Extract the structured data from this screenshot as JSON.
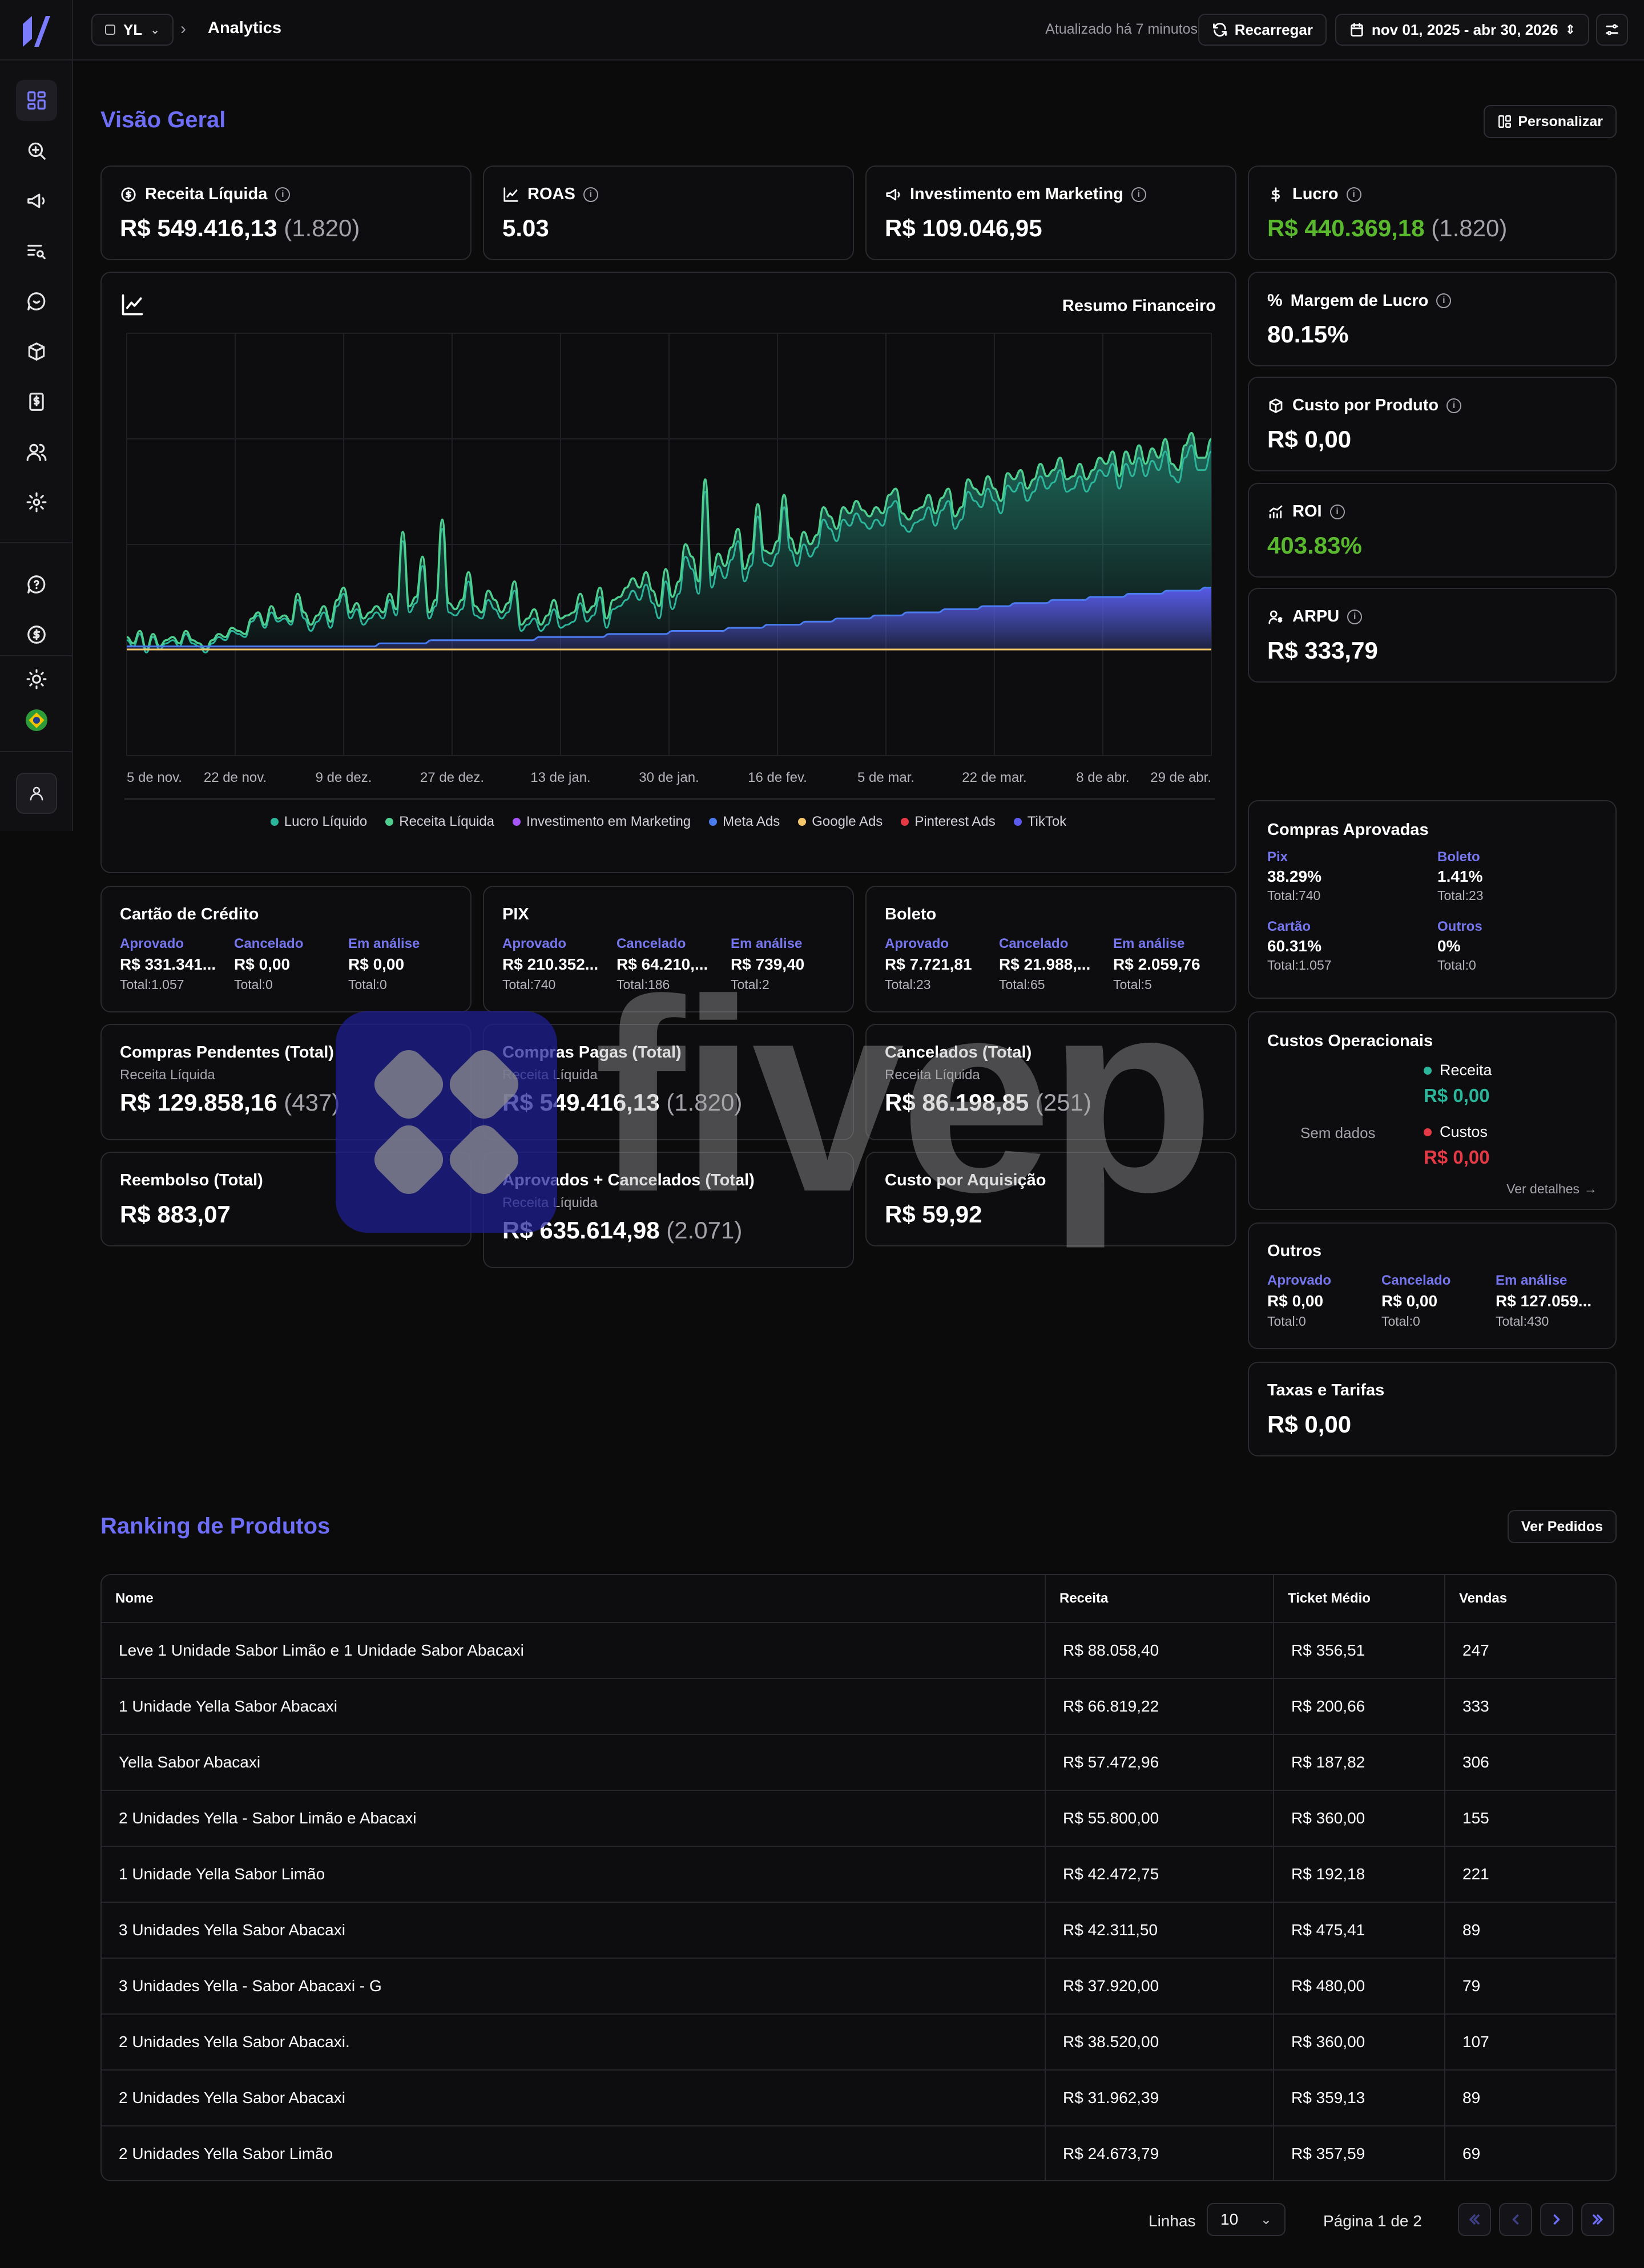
{
  "topbar": {
    "workspace": "YL",
    "breadcrumb": "Analytics",
    "updated": "Atualizado há 7 minutos",
    "reload": "Recarregar",
    "date_range": "nov 01, 2025 - abr 30, 2026"
  },
  "overview": {
    "title": "Visão Geral",
    "customize": "Personalizar",
    "kpis": {
      "receita": {
        "label": "Receita Líquida",
        "value": "R$ 549.416,13",
        "count": "(1.820)"
      },
      "roas": {
        "label": "ROAS",
        "value": "5.03"
      },
      "investimento": {
        "label": "Investimento em Marketing",
        "value": "R$ 109.046,95"
      },
      "lucro": {
        "label": "Lucro",
        "value": "R$ 440.369,18",
        "count": "(1.820)"
      },
      "margem": {
        "label": "Margem de Lucro",
        "value": "80.15%"
      },
      "custo_produto": {
        "label": "Custo por Produto",
        "value": "R$ 0,00"
      },
      "roi": {
        "label": "ROI",
        "value": "403.83%"
      },
      "arpu": {
        "label": "ARPU",
        "value": "R$ 333,79"
      }
    }
  },
  "colors": {
    "accent": "#6d6df5",
    "lucro": "#2bb59a",
    "receita": "#4fcf8f",
    "investimento": "#a855f7",
    "meta": "#4a7cf0",
    "google": "#f5c66a",
    "pinterest": "#e63946",
    "tiktok": "#5b5bf0",
    "positive": "#5ab82e"
  },
  "chart_data": {
    "type": "area",
    "title": "Resumo Financeiro",
    "x_ticks": [
      "5 de nov.",
      "22 de nov.",
      "9 de dez.",
      "27 de dez.",
      "13 de jan.",
      "30 de jan.",
      "16 de fev.",
      "5 de mar.",
      "22 de mar.",
      "8 de abr.",
      "29 de abr."
    ],
    "grid": true,
    "legend_position": "bottom",
    "series_names": [
      "Lucro Líquido",
      "Receita Líquida",
      "Investimento em Marketing",
      "Meta Ads",
      "Google Ads",
      "Pinterest Ads",
      "TikTok"
    ],
    "receita": [
      0.04,
      0.02,
      0.06,
      0.0,
      0.05,
      0.01,
      0.03,
      0.04,
      0.02,
      0.06,
      0.03,
      0.02,
      0.0,
      0.03,
      0.05,
      0.04,
      0.07,
      0.06,
      0.05,
      0.1,
      0.12,
      0.08,
      0.14,
      0.1,
      0.11,
      0.09,
      0.18,
      0.12,
      0.08,
      0.11,
      0.14,
      0.09,
      0.16,
      0.2,
      0.12,
      0.15,
      0.1,
      0.12,
      0.14,
      0.12,
      0.18,
      0.13,
      0.38,
      0.14,
      0.17,
      0.3,
      0.12,
      0.16,
      0.42,
      0.15,
      0.13,
      0.16,
      0.25,
      0.14,
      0.12,
      0.19,
      0.16,
      0.12,
      0.15,
      0.22,
      0.08,
      0.1,
      0.13,
      0.08,
      0.11,
      0.16,
      0.1,
      0.11,
      0.12,
      0.18,
      0.12,
      0.14,
      0.2,
      0.1,
      0.16,
      0.17,
      0.2,
      0.23,
      0.2,
      0.25,
      0.19,
      0.14,
      0.26,
      0.17,
      0.22,
      0.34,
      0.3,
      0.22,
      0.55,
      0.24,
      0.31,
      0.27,
      0.33,
      0.39,
      0.26,
      0.31,
      0.47,
      0.32,
      0.31,
      0.35,
      0.5,
      0.36,
      0.31,
      0.38,
      0.34,
      0.37,
      0.46,
      0.43,
      0.39,
      0.46,
      0.44,
      0.48,
      0.45,
      0.43,
      0.46,
      0.44,
      0.5,
      0.52,
      0.44,
      0.42,
      0.45,
      0.46,
      0.5,
      0.44,
      0.49,
      0.52,
      0.43,
      0.46,
      0.55,
      0.52,
      0.5,
      0.56,
      0.52,
      0.48,
      0.57,
      0.55,
      0.58,
      0.52,
      0.55,
      0.6,
      0.56,
      0.58,
      0.62,
      0.55,
      0.56,
      0.6,
      0.55,
      0.58,
      0.62,
      0.6,
      0.64,
      0.56,
      0.64,
      0.6,
      0.66,
      0.6,
      0.65,
      0.62,
      0.68,
      0.6,
      0.58,
      0.66,
      0.7,
      0.62,
      0.62,
      0.68
    ],
    "lucro": [
      0.03,
      0.01,
      0.05,
      -0.01,
      0.04,
      0.0,
      0.02,
      0.03,
      0.01,
      0.05,
      0.02,
      0.01,
      -0.01,
      0.02,
      0.04,
      0.03,
      0.06,
      0.05,
      0.04,
      0.09,
      0.11,
      0.07,
      0.12,
      0.09,
      0.1,
      0.08,
      0.16,
      0.1,
      0.06,
      0.09,
      0.12,
      0.07,
      0.14,
      0.18,
      0.1,
      0.13,
      0.08,
      0.1,
      0.12,
      0.1,
      0.16,
      0.11,
      0.35,
      0.12,
      0.15,
      0.27,
      0.1,
      0.14,
      0.39,
      0.12,
      0.11,
      0.13,
      0.22,
      0.11,
      0.1,
      0.16,
      0.13,
      0.1,
      0.12,
      0.19,
      0.06,
      0.08,
      0.1,
      0.06,
      0.08,
      0.13,
      0.07,
      0.08,
      0.09,
      0.15,
      0.09,
      0.11,
      0.17,
      0.07,
      0.13,
      0.14,
      0.16,
      0.19,
      0.16,
      0.21,
      0.15,
      0.1,
      0.22,
      0.13,
      0.18,
      0.3,
      0.26,
      0.18,
      0.51,
      0.2,
      0.27,
      0.23,
      0.29,
      0.35,
      0.22,
      0.27,
      0.43,
      0.28,
      0.27,
      0.31,
      0.46,
      0.32,
      0.27,
      0.34,
      0.3,
      0.33,
      0.42,
      0.39,
      0.35,
      0.42,
      0.4,
      0.44,
      0.41,
      0.39,
      0.42,
      0.4,
      0.46,
      0.48,
      0.4,
      0.38,
      0.41,
      0.42,
      0.46,
      0.4,
      0.45,
      0.48,
      0.39,
      0.42,
      0.51,
      0.48,
      0.46,
      0.52,
      0.48,
      0.44,
      0.53,
      0.51,
      0.54,
      0.48,
      0.51,
      0.56,
      0.52,
      0.54,
      0.58,
      0.51,
      0.52,
      0.56,
      0.51,
      0.54,
      0.58,
      0.56,
      0.6,
      0.52,
      0.6,
      0.56,
      0.62,
      0.56,
      0.61,
      0.58,
      0.64,
      0.56,
      0.54,
      0.62,
      0.66,
      0.58,
      0.58,
      0.64
    ],
    "meta": [
      0.01,
      0.01,
      0.01,
      0.01,
      0.01,
      0.01,
      0.01,
      0.01,
      0.01,
      0.01,
      0.01,
      0.01,
      0.01,
      0.01,
      0.01,
      0.01,
      0.01,
      0.01,
      0.01,
      0.01,
      0.01,
      0.01,
      0.01,
      0.01,
      0.01,
      0.01,
      0.01,
      0.01,
      0.01,
      0.01,
      0.01,
      0.01,
      0.01,
      0.01,
      0.01,
      0.01,
      0.01,
      0.01,
      0.01,
      0.01,
      0.02,
      0.02,
      0.02,
      0.02,
      0.02,
      0.02,
      0.02,
      0.02,
      0.03,
      0.03,
      0.03,
      0.03,
      0.03,
      0.03,
      0.03,
      0.03,
      0.03,
      0.03,
      0.03,
      0.03,
      0.03,
      0.03,
      0.03,
      0.03,
      0.03,
      0.04,
      0.04,
      0.04,
      0.04,
      0.04,
      0.04,
      0.04,
      0.04,
      0.04,
      0.04,
      0.04,
      0.05,
      0.05,
      0.05,
      0.05,
      0.05,
      0.05,
      0.05,
      0.05,
      0.05,
      0.05,
      0.06,
      0.06,
      0.06,
      0.06,
      0.06,
      0.06,
      0.06,
      0.06,
      0.06,
      0.07,
      0.07,
      0.07,
      0.07,
      0.07,
      0.07,
      0.08,
      0.08,
      0.08,
      0.08,
      0.08,
      0.08,
      0.09,
      0.09,
      0.09,
      0.09,
      0.09,
      0.1,
      0.1,
      0.1,
      0.1,
      0.1,
      0.1,
      0.11,
      0.11,
      0.11,
      0.11,
      0.11,
      0.12,
      0.12,
      0.12,
      0.12,
      0.12,
      0.12,
      0.13,
      0.13,
      0.13,
      0.13,
      0.13,
      0.13,
      0.14,
      0.14,
      0.14,
      0.14,
      0.14,
      0.15,
      0.15,
      0.15,
      0.15,
      0.15,
      0.15,
      0.16,
      0.16,
      0.16,
      0.16,
      0.16,
      0.16,
      0.17,
      0.17,
      0.17,
      0.17,
      0.17,
      0.17,
      0.18,
      0.18,
      0.18,
      0.18,
      0.18,
      0.18,
      0.19,
      0.19,
      0.19,
      0.19,
      0.19,
      0.19,
      0.2,
      0.2
    ],
    "google": [
      0.0,
      0.0,
      0.0,
      0.0,
      0.0,
      0.0,
      0.0,
      0.0,
      0.0,
      0.0,
      0.0,
      0.0,
      0.0,
      0.0,
      0.0,
      0.0,
      0.0,
      0.0,
      0.0,
      0.0,
      0.0,
      0.0,
      0.0,
      0.0,
      0.0,
      0.0,
      0.0,
      0.0,
      0.0,
      0.0,
      0.0,
      0.0,
      0.0,
      0.0,
      0.0,
      0.0,
      0.0,
      0.0,
      0.0,
      0.0,
      0.0,
      0.0,
      0.0,
      0.0,
      0.0,
      0.0,
      0.0,
      0.0,
      0.0,
      0.0,
      0.0,
      0.0,
      0.0,
      0.0,
      0.0,
      0.0,
      0.0,
      0.0,
      0.0,
      0.0,
      0.0,
      0.0,
      0.0,
      0.0,
      0.0,
      0.0,
      0.0,
      0.0,
      0.0,
      0.0,
      0.0,
      0.0,
      0.0,
      0.0,
      0.0,
      0.0,
      0.0,
      0.0,
      0.0,
      0.0,
      0.0,
      0.0,
      0.0,
      0.0,
      0.0,
      0.0,
      0.0,
      0.0,
      0.0,
      0.0,
      0.0,
      0.0,
      0.0,
      0.0,
      0.0,
      0.0,
      0.0,
      0.0,
      0.0,
      0.0,
      0.0,
      0.0,
      0.0,
      0.0,
      0.0,
      0.0,
      0.0,
      0.0,
      0.0,
      0.0,
      0.0,
      0.0,
      0.0,
      0.0,
      0.0,
      0.0,
      0.0,
      0.0,
      0.0,
      0.0,
      0.0,
      0.0,
      0.0,
      0.0,
      0.0,
      0.0,
      0.0,
      0.0,
      0.0,
      0.0,
      0.0,
      0.0,
      0.0,
      0.0,
      0.0,
      0.0,
      0.0,
      0.0,
      0.0,
      0.0,
      0.0,
      0.0,
      0.0,
      0.0,
      0.0,
      0.0,
      0.0,
      0.0,
      0.0,
      0.0,
      0.0,
      0.0,
      0.0,
      0.0,
      0.0,
      0.0,
      0.0,
      0.0,
      0.0,
      0.0,
      0.0,
      0.0,
      0.0,
      0.0,
      0.0,
      0.0,
      0.0,
      0.0,
      0.0,
      0.0,
      0.0,
      0.0,
      0.0,
      0.0
    ]
  },
  "payments": {
    "cartao": {
      "title": "Cartão de Crédito",
      "cols": [
        {
          "label": "Aprovado",
          "value": "R$ 331.341...",
          "total": "Total:1.057"
        },
        {
          "label": "Cancelado",
          "value": "R$ 0,00",
          "total": "Total:0"
        },
        {
          "label": "Em análise",
          "value": "R$ 0,00",
          "total": "Total:0"
        }
      ]
    },
    "pix": {
      "title": "PIX",
      "cols": [
        {
          "label": "Aprovado",
          "value": "R$ 210.352...",
          "total": "Total:740"
        },
        {
          "label": "Cancelado",
          "value": "R$ 64.210,...",
          "total": "Total:186"
        },
        {
          "label": "Em análise",
          "value": "R$ 739,40",
          "total": "Total:2"
        }
      ]
    },
    "boleto": {
      "title": "Boleto",
      "cols": [
        {
          "label": "Aprovado",
          "value": "R$ 7.721,81",
          "total": "Total:23"
        },
        {
          "label": "Cancelado",
          "value": "R$ 21.988,...",
          "total": "Total:65"
        },
        {
          "label": "Em análise",
          "value": "R$ 2.059,76",
          "total": "Total:5"
        }
      ]
    },
    "outros": {
      "title": "Outros",
      "cols": [
        {
          "label": "Aprovado",
          "value": "R$ 0,00",
          "total": "Total:0"
        },
        {
          "label": "Cancelado",
          "value": "R$ 0,00",
          "total": "Total:0"
        },
        {
          "label": "Em análise",
          "value": "R$ 127.059...",
          "total": "Total:430"
        }
      ]
    }
  },
  "totals": {
    "pendentes": {
      "title": "Compras Pendentes (Total)",
      "sub": "Receita Líquida",
      "value": "R$ 129.858,16",
      "count": "(437)"
    },
    "pagas": {
      "title": "Compras Pagas (Total)",
      "sub": "Receita Líquida",
      "value": "R$ 549.416,13",
      "count": "(1.820)"
    },
    "cancelados": {
      "title": "Cancelados (Total)",
      "sub": "Receita Líquida",
      "value": "R$ 86.198,85",
      "count": "(251)"
    },
    "reembolso": {
      "title": "Reembolso (Total)",
      "value": "R$ 883,07"
    },
    "aprov_canc": {
      "title": "Aprovados + Cancelados (Total)",
      "sub": "Receita Líquida",
      "value": "R$ 635.614,98",
      "count": "(2.071)"
    },
    "cac": {
      "title": "Custo por Aquisição",
      "value": "R$ 59,92"
    },
    "taxas": {
      "title": "Taxas e Tarifas",
      "value": "R$ 0,00"
    }
  },
  "compras_aprovadas": {
    "title": "Compras Aprovadas",
    "cells": [
      {
        "label": "Pix",
        "value": "38.29%",
        "total": "Total:740"
      },
      {
        "label": "Boleto",
        "value": "1.41%",
        "total": "Total:23"
      },
      {
        "label": "Cartão",
        "value": "60.31%",
        "total": "Total:1.057"
      },
      {
        "label": "Outros",
        "value": "0%",
        "total": "Total:0"
      }
    ]
  },
  "custos_operacionais": {
    "title": "Custos Operacionais",
    "empty": "Sem dados",
    "receita_label": "Receita",
    "receita_value": "R$ 0,00",
    "custos_label": "Custos",
    "custos_value": "R$ 0,00",
    "details": "Ver detalhes"
  },
  "ranking": {
    "title": "Ranking de Produtos",
    "orders_button": "Ver Pedidos",
    "headers": [
      "Nome",
      "Receita",
      "Ticket Médio",
      "Vendas"
    ],
    "rows": [
      [
        "Leve 1 Unidade Sabor Limão e 1 Unidade Sabor Abacaxi",
        "R$ 88.058,40",
        "R$ 356,51",
        "247"
      ],
      [
        "1 Unidade Yella Sabor Abacaxi",
        "R$ 66.819,22",
        "R$ 200,66",
        "333"
      ],
      [
        "Yella Sabor Abacaxi",
        "R$ 57.472,96",
        "R$ 187,82",
        "306"
      ],
      [
        "2 Unidades Yella - Sabor Limão e Abacaxi",
        "R$ 55.800,00",
        "R$ 360,00",
        "155"
      ],
      [
        "1 Unidade Yella Sabor Limão",
        "R$ 42.472,75",
        "R$ 192,18",
        "221"
      ],
      [
        "3 Unidades Yella Sabor Abacaxi",
        "R$ 42.311,50",
        "R$ 475,41",
        "89"
      ],
      [
        "3 Unidades Yella - Sabor Abacaxi - G",
        "R$ 37.920,00",
        "R$ 480,00",
        "79"
      ],
      [
        "2 Unidades Yella Sabor Abacaxi.",
        "R$ 38.520,00",
        "R$ 360,00",
        "107"
      ],
      [
        "2 Unidades Yella Sabor Abacaxi",
        "R$ 31.962,39",
        "R$ 359,13",
        "89"
      ],
      [
        "2 Unidades Yella Sabor Limão",
        "R$ 24.673,79",
        "R$ 357,59",
        "69"
      ]
    ],
    "rows_label": "Linhas",
    "rows_value": "10",
    "page_label": "Página 1 de 2"
  },
  "watermark": {
    "text": "fivep"
  }
}
